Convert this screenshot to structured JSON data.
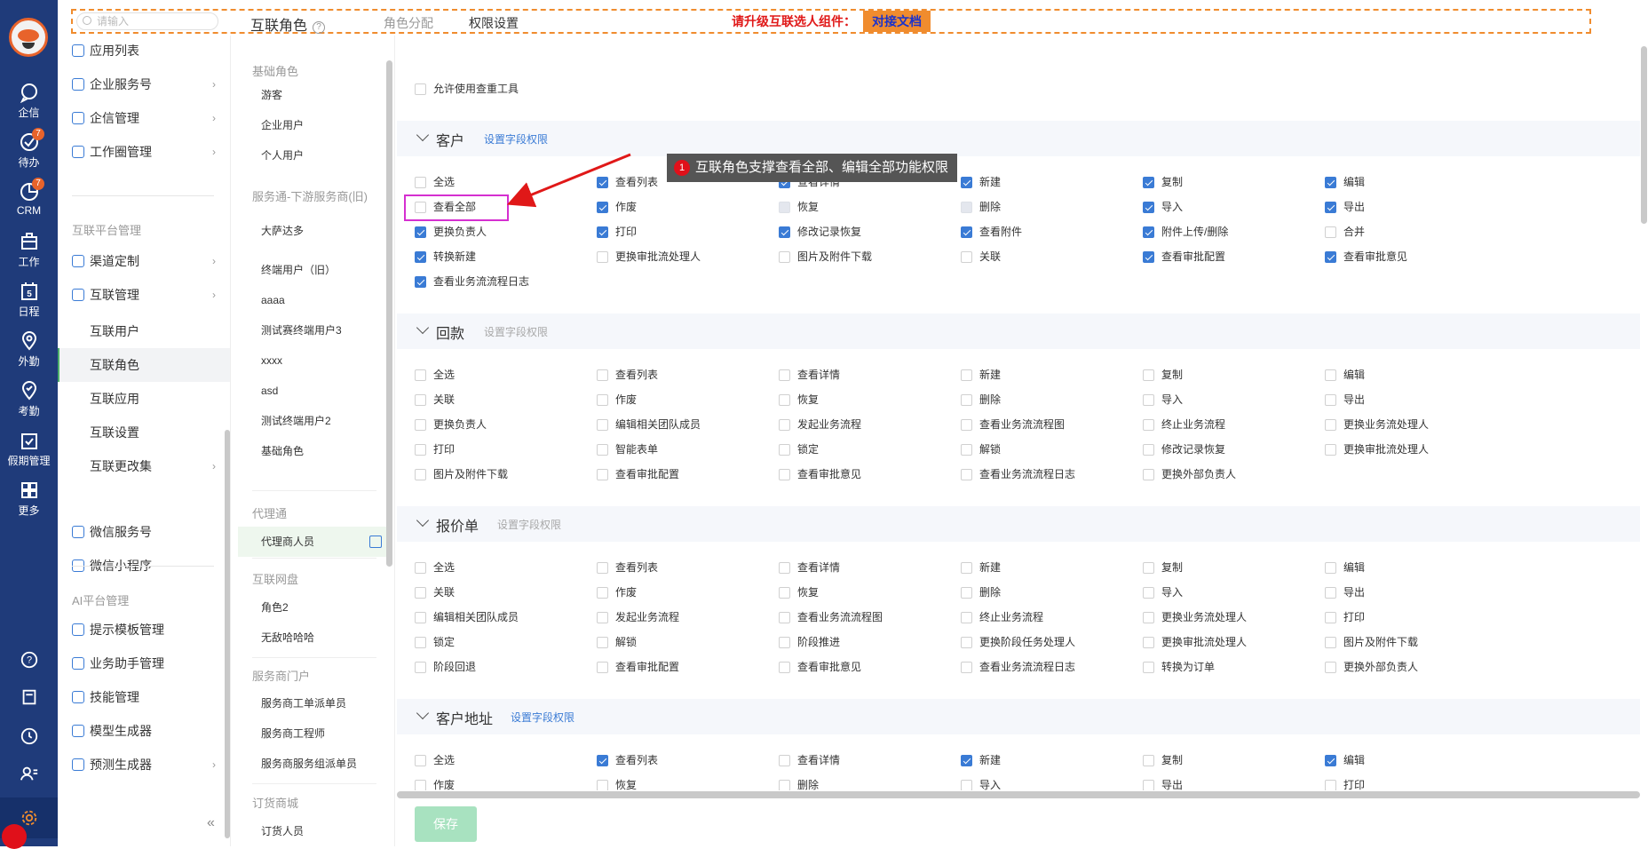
{
  "rail": {
    "items": [
      {
        "label": "企信",
        "icon": "chat-icon"
      },
      {
        "label": "待办",
        "icon": "check-circle-icon",
        "badge": "7"
      },
      {
        "label": "CRM",
        "icon": "pie-icon",
        "badge": "7"
      },
      {
        "label": "工作",
        "icon": "briefcase-icon"
      },
      {
        "label": "日程",
        "icon": "calendar-icon",
        "day": "5"
      },
      {
        "label": "外勤",
        "icon": "location-icon"
      },
      {
        "label": "考勤",
        "icon": "clock-check-icon"
      },
      {
        "label": "假期管理",
        "icon": "calendar-check-icon"
      },
      {
        "label": "更多",
        "icon": "grid-icon"
      }
    ]
  },
  "nav": {
    "top_items": [
      {
        "label": "应用列表",
        "chevron": false
      },
      {
        "label": "企业服务号",
        "chevron": true
      },
      {
        "label": "企信管理",
        "chevron": true
      },
      {
        "label": "工作圈管理",
        "chevron": true
      }
    ],
    "group_interconnect": "互联平台管理",
    "interconnect_items": [
      {
        "label": "渠道定制",
        "chevron": true
      },
      {
        "label": "互联管理",
        "chevron": true
      }
    ],
    "sub_items": [
      "互联用户",
      "互联角色",
      "互联应用",
      "互联设置",
      "互联更改集"
    ],
    "after_items": [
      {
        "label": "微信服务号",
        "chevron": false
      },
      {
        "label": "微信小程序",
        "chevron": false
      }
    ],
    "group_ai": "AI平台管理",
    "ai_items": [
      {
        "label": "提示模板管理",
        "chevron": false
      },
      {
        "label": "业务助手管理",
        "chevron": false
      },
      {
        "label": "技能管理",
        "chevron": false
      },
      {
        "label": "模型生成器",
        "chevron": false
      },
      {
        "label": "预测生成器",
        "chevron": true
      }
    ],
    "collapse": "«"
  },
  "topbar": {
    "search_placeholder": "请输入",
    "title": "互联角色",
    "help": "?",
    "tab_roles": "角色分配",
    "tab_perms": "权限设置",
    "upgrade": "请升级互联选人组件：",
    "doc_button": "对接文档"
  },
  "roles": {
    "groups": [
      {
        "title": "基础角色",
        "items": [
          "游客",
          "企业用户",
          "个人用户"
        ]
      },
      {
        "title": "服务通-下游服务商(旧)",
        "items": [
          "大萨达多"
        ]
      },
      {
        "title": "",
        "items": [
          "终端用户（旧）",
          "aaaa",
          "测试赛终端用户3",
          "xxxx",
          "asd",
          "测试终端用户2",
          "基础角色"
        ]
      },
      {
        "title": "代理通",
        "items": [
          "代理商人员"
        ]
      },
      {
        "title": "互联网盘",
        "items": [
          "角色2",
          "无敌哈哈哈"
        ]
      },
      {
        "title": "服务商门户",
        "items": [
          "服务商工单派单员",
          "服务商工程师",
          "服务商服务组派单员"
        ]
      },
      {
        "title": "订货商城",
        "items": [
          "订货人员"
        ]
      }
    ]
  },
  "perm": {
    "check_tool": "允许使用查重工具",
    "sections": [
      {
        "name": "客户",
        "link": "设置字段权限",
        "link_active": true
      },
      {
        "name": "回款",
        "link": "设置字段权限",
        "link_active": false
      },
      {
        "name": "报价单",
        "link": "设置字段权限",
        "link_active": false
      },
      {
        "name": "客户地址",
        "link": "设置字段权限",
        "link_active": true
      }
    ],
    "customer": [
      [
        "全选",
        false,
        false
      ],
      [
        "查看列表",
        true,
        false
      ],
      [
        "查看详情",
        true,
        false
      ],
      [
        "新建",
        true,
        false
      ],
      [
        "复制",
        true,
        false
      ],
      [
        "编辑",
        true,
        false
      ],
      [
        "查看全部",
        false,
        false
      ],
      [
        "作废",
        true,
        false
      ],
      [
        "恢复",
        false,
        true
      ],
      [
        "删除",
        false,
        true
      ],
      [
        "导入",
        true,
        false
      ],
      [
        "导出",
        true,
        false
      ],
      [
        "更换负责人",
        true,
        false
      ],
      [
        "打印",
        true,
        false
      ],
      [
        "修改记录恢复",
        true,
        false
      ],
      [
        "查看附件",
        true,
        false
      ],
      [
        "附件上传/删除",
        true,
        false
      ],
      [
        "合并",
        false,
        false
      ],
      [
        "转换新建",
        true,
        false
      ],
      [
        "更换审批流处理人",
        false,
        false
      ],
      [
        "图片及附件下载",
        false,
        false
      ],
      [
        "关联",
        false,
        false
      ],
      [
        "查看审批配置",
        true,
        false
      ],
      [
        "查看审批意见",
        true,
        false
      ],
      [
        "查看业务流流程日志",
        true,
        false
      ]
    ],
    "payment": [
      [
        "全选",
        false,
        false
      ],
      [
        "查看列表",
        false,
        false
      ],
      [
        "查看详情",
        false,
        false
      ],
      [
        "新建",
        false,
        false
      ],
      [
        "复制",
        false,
        false
      ],
      [
        "编辑",
        false,
        false
      ],
      [
        "关联",
        false,
        false
      ],
      [
        "作废",
        false,
        false
      ],
      [
        "恢复",
        false,
        false
      ],
      [
        "删除",
        false,
        false
      ],
      [
        "导入",
        false,
        false
      ],
      [
        "导出",
        false,
        false
      ],
      [
        "更换负责人",
        false,
        false
      ],
      [
        "编辑相关团队成员",
        false,
        false
      ],
      [
        "发起业务流程",
        false,
        false
      ],
      [
        "查看业务流流程图",
        false,
        false
      ],
      [
        "终止业务流程",
        false,
        false
      ],
      [
        "更换业务流处理人",
        false,
        false
      ],
      [
        "打印",
        false,
        false
      ],
      [
        "智能表单",
        false,
        false
      ],
      [
        "锁定",
        false,
        false
      ],
      [
        "解锁",
        false,
        false
      ],
      [
        "修改记录恢复",
        false,
        false
      ],
      [
        "更换审批流处理人",
        false,
        false
      ],
      [
        "图片及附件下载",
        false,
        false
      ],
      [
        "查看审批配置",
        false,
        false
      ],
      [
        "查看审批意见",
        false,
        false
      ],
      [
        "查看业务流流程日志",
        false,
        false
      ],
      [
        "更换外部负责人",
        false,
        false
      ]
    ],
    "quote": [
      [
        "全选",
        false,
        false
      ],
      [
        "查看列表",
        false,
        false
      ],
      [
        "查看详情",
        false,
        false
      ],
      [
        "新建",
        false,
        false
      ],
      [
        "复制",
        false,
        false
      ],
      [
        "编辑",
        false,
        false
      ],
      [
        "关联",
        false,
        false
      ],
      [
        "作废",
        false,
        false
      ],
      [
        "恢复",
        false,
        false
      ],
      [
        "删除",
        false,
        false
      ],
      [
        "导入",
        false,
        false
      ],
      [
        "导出",
        false,
        false
      ],
      [
        "编辑相关团队成员",
        false,
        false
      ],
      [
        "发起业务流程",
        false,
        false
      ],
      [
        "查看业务流流程图",
        false,
        false
      ],
      [
        "终止业务流程",
        false,
        false
      ],
      [
        "更换业务流处理人",
        false,
        false
      ],
      [
        "打印",
        false,
        false
      ],
      [
        "锁定",
        false,
        false
      ],
      [
        "解锁",
        false,
        false
      ],
      [
        "阶段推进",
        false,
        false
      ],
      [
        "更换阶段任务处理人",
        false,
        false
      ],
      [
        "更换审批流处理人",
        false,
        false
      ],
      [
        "图片及附件下载",
        false,
        false
      ],
      [
        "阶段回退",
        false,
        false
      ],
      [
        "查看审批配置",
        false,
        false
      ],
      [
        "查看审批意见",
        false,
        false
      ],
      [
        "查看业务流流程日志",
        false,
        false
      ],
      [
        "转换为订单",
        false,
        false
      ],
      [
        "更换外部负责人",
        false,
        false
      ]
    ],
    "address": [
      [
        "全选",
        false,
        false
      ],
      [
        "查看列表",
        true,
        false
      ],
      [
        "查看详情",
        false,
        false
      ],
      [
        "新建",
        true,
        false
      ],
      [
        "复制",
        false,
        false
      ],
      [
        "编辑",
        true,
        false
      ],
      [
        "作废",
        false,
        false
      ],
      [
        "恢复",
        false,
        false
      ],
      [
        "删除",
        false,
        false
      ],
      [
        "导入",
        false,
        false
      ],
      [
        "导出",
        false,
        false
      ],
      [
        "打印",
        false,
        false
      ]
    ]
  },
  "annotation": {
    "number": "1",
    "text": "互联角色支撑查看全部、编辑全部功能权限"
  },
  "save_label": "保存",
  "colors": {
    "rail": "#1f3b7a",
    "accent": "#3a7bd5",
    "green": "#4cae6a",
    "orange": "#f08c2e",
    "highlight": "#d52fd0"
  }
}
